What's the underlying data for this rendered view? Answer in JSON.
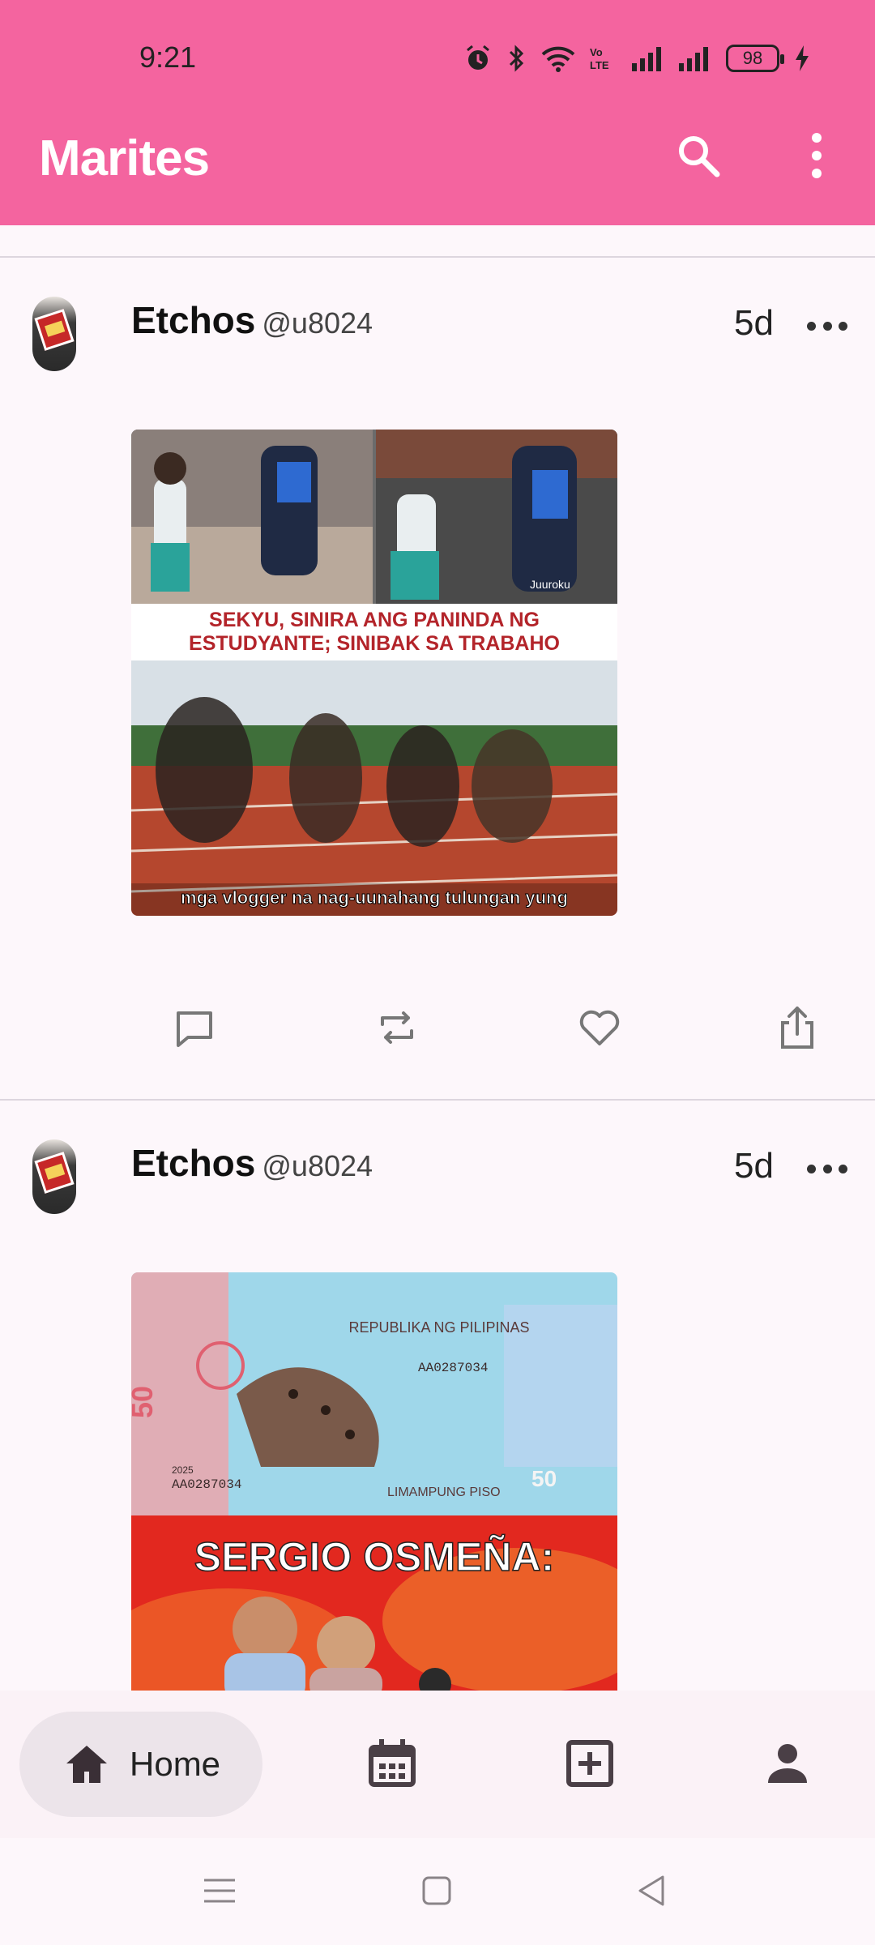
{
  "status_bar": {
    "time": "9:21",
    "battery": "98"
  },
  "app_bar": {
    "title": "Marites"
  },
  "posts": [
    {
      "author": "Etchos",
      "handle": "@u8024",
      "age": "5d",
      "image_caption_top": "SEKYU, SINIRA ANG PANINDA NG ESTUDYANTE; SINIBAK SA TRABAHO",
      "image_caption_bottom": "mga vlogger na nag-uunahang tulungan yung",
      "image_watermark": "Juuroku"
    },
    {
      "author": "Etchos",
      "handle": "@u8024",
      "age": "5d",
      "banknote_header": "REPUBLIKA NG PILIPINAS",
      "banknote_serial": "AA0287034",
      "banknote_serial_left": "AA0287034",
      "banknote_year": "2025",
      "banknote_denomination_text": "LIMAMPUNG PISO",
      "banknote_value": "50",
      "headline": "SERGIO OSMEÑA:"
    }
  ],
  "bottom_nav": {
    "home_label": "Home",
    "items": [
      "home-icon",
      "calendar-icon",
      "add-box-icon",
      "person-icon"
    ]
  },
  "colors": {
    "accent": "#f4649f",
    "background": "#fdf7fb",
    "nav_pill": "#ece4ea"
  }
}
